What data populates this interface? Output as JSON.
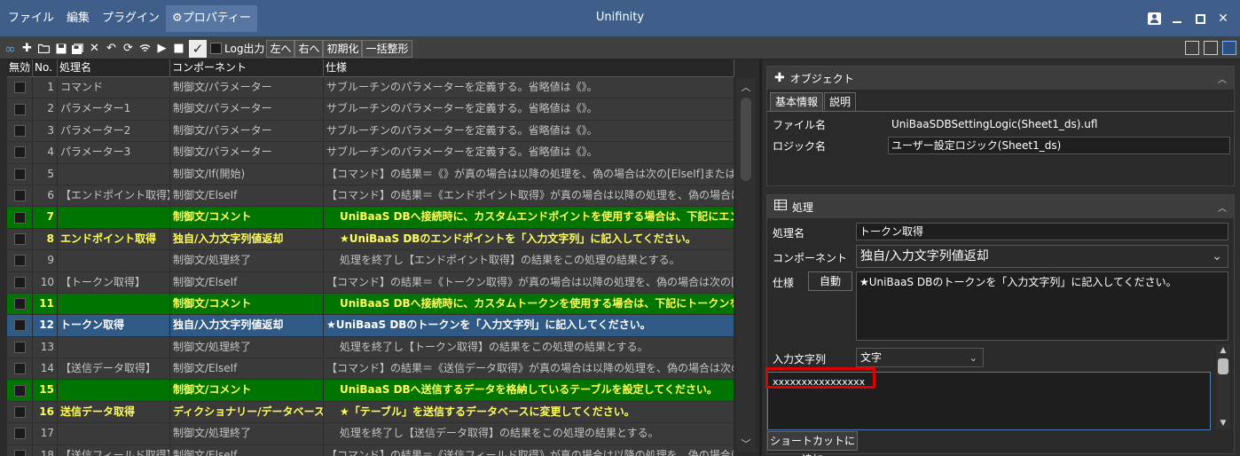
{
  "window": {
    "title": "Unifinity",
    "menu": [
      {
        "label": "ファイル"
      },
      {
        "label": "編集"
      },
      {
        "label": "プラグイン"
      },
      {
        "label": "⚙プロパティー"
      }
    ]
  },
  "toolbar": {
    "icons": [
      "unifinity-logo-icon",
      "add-icon",
      "open-folder-icon",
      "save-icon",
      "save-all-icon",
      "delete-icon",
      "undo-icon",
      "refresh-icon",
      "wifi-icon",
      "play-icon",
      "stop-icon"
    ],
    "log_toggle_label": "Log出力",
    "btn_left": "左へ",
    "btn_right": "右へ",
    "btn_init": "初期化",
    "btn_format": "一括整形"
  },
  "grid": {
    "headers": {
      "disabled": "無効",
      "no": "No.",
      "name": "処理名",
      "component": "コンポーネント",
      "spec": "仕様"
    },
    "rows": [
      {
        "no": "1",
        "name": "コマンド",
        "component": "制御文/パラメーター",
        "spec": "サブルーチンのパラメーターを定義する。省略値は《》。"
      },
      {
        "no": "2",
        "name": "パラメーター1",
        "component": "制御文/パラメーター",
        "spec": "サブルーチンのパラメーターを定義する。省略値は《》。"
      },
      {
        "no": "3",
        "name": "パラメーター2",
        "component": "制御文/パラメーター",
        "spec": "サブルーチンのパラメーターを定義する。省略値は《》。"
      },
      {
        "no": "4",
        "name": "パラメーター3",
        "component": "制御文/パラメーター",
        "spec": "サブルーチンのパラメーターを定義する。省略値は《》。"
      },
      {
        "no": "5",
        "name": "",
        "component": "制御文/If(開始)",
        "spec": "【コマンド】の結果＝《》が真の場合は以降の処理を、偽の場合は次の[ElseIf]または[Else]ま"
      },
      {
        "no": "6",
        "name": "【エンドポイント取得】",
        "component": "制御文/ElseIf",
        "spec": "【コマンド】の結果＝《エンドポイント取得》が真の場合は以降の処理を、偽の場合は次の[E"
      },
      {
        "no": "7",
        "name": "",
        "component": "制御文/コメント",
        "spec": "UniBaaS DBへ接続時に、カスタムエンドポイントを使用する場合は、下記にエンドポイン"
      },
      {
        "no": "8",
        "name": "エンドポイント取得",
        "component": "独自/入力文字列値返却",
        "spec": "★UniBaaS DBのエンドポイントを「入力文字列」に記入してください。"
      },
      {
        "no": "9",
        "name": "",
        "component": "制御文/処理終了",
        "spec": "処理を終了し【エンドポイント取得】の結果をこの処理の結果とする。"
      },
      {
        "no": "10",
        "name": "【トークン取得】",
        "component": "制御文/ElseIf",
        "spec": "【コマンド】の結果＝《トークン取得》が真の場合は以降の処理を、偽の場合は次の[ElseIf]ま"
      },
      {
        "no": "11",
        "name": "",
        "component": "制御文/コメント",
        "spec": "UniBaaS DBへ接続時に、カスタムトークンを使用する場合は、下記にトークンを設定して"
      },
      {
        "no": "12",
        "name": "トークン取得",
        "component": "独自/入力文字列値返却",
        "spec": "★UniBaaS DBのトークンを「入力文字列」に記入してください。"
      },
      {
        "no": "13",
        "name": "",
        "component": "制御文/処理終了",
        "spec": "処理を終了し【トークン取得】の結果をこの処理の結果とする。"
      },
      {
        "no": "14",
        "name": "【送信データ取得】",
        "component": "制御文/ElseIf",
        "spec": "【コマンド】の結果＝《送信データ取得》が真の場合は以降の処理を、偽の場合は次の[Else"
      },
      {
        "no": "15",
        "name": "",
        "component": "制御文/コメント",
        "spec": "UniBaaS DBへ送信するデータを格納しているテーブルを設定してください。"
      },
      {
        "no": "16",
        "name": "送信データ取得",
        "component": "ディクショナリー/データベース読込",
        "spec": "★「テーブル」を送信するデータベースに変更してください。"
      },
      {
        "no": "17",
        "name": "",
        "component": "制御文/処理終了",
        "spec": "処理を終了し【送信データ取得】の結果をこの処理の結果とする。"
      },
      {
        "no": "18",
        "name": "【送信フィールド取得】",
        "component": "制御文/ElseIf",
        "spec": "【コマンド】の結果＝《送信フィールド取得》が真の場合は以降の処理を、偽の場合は次の[E"
      }
    ]
  },
  "object_panel": {
    "title": "オブジェクト",
    "tabs": [
      "基本情報",
      "説明"
    ],
    "file_label": "ファイル名",
    "file_value": "UniBaaSDBSettingLogic(Sheet1_ds).ufl",
    "logic_label": "ロジック名",
    "logic_value": "ユーザー設定ロジック(Sheet1_ds)"
  },
  "process_panel": {
    "title": "処理",
    "name_label": "処理名",
    "name_value": "トークン取得",
    "component_label": "コンポーネント",
    "component_value": "独自/入力文字列値返却",
    "spec_label": "仕様",
    "auto_button": "自動",
    "spec_value": "★UniBaaS DBのトークンを「入力文字列」に記入してください。",
    "input_label": "入力文字列",
    "input_type": "文字",
    "input_value": "xxxxxxxxxxxxxxxx",
    "shortcut_button": "ショートカットに追加"
  }
}
